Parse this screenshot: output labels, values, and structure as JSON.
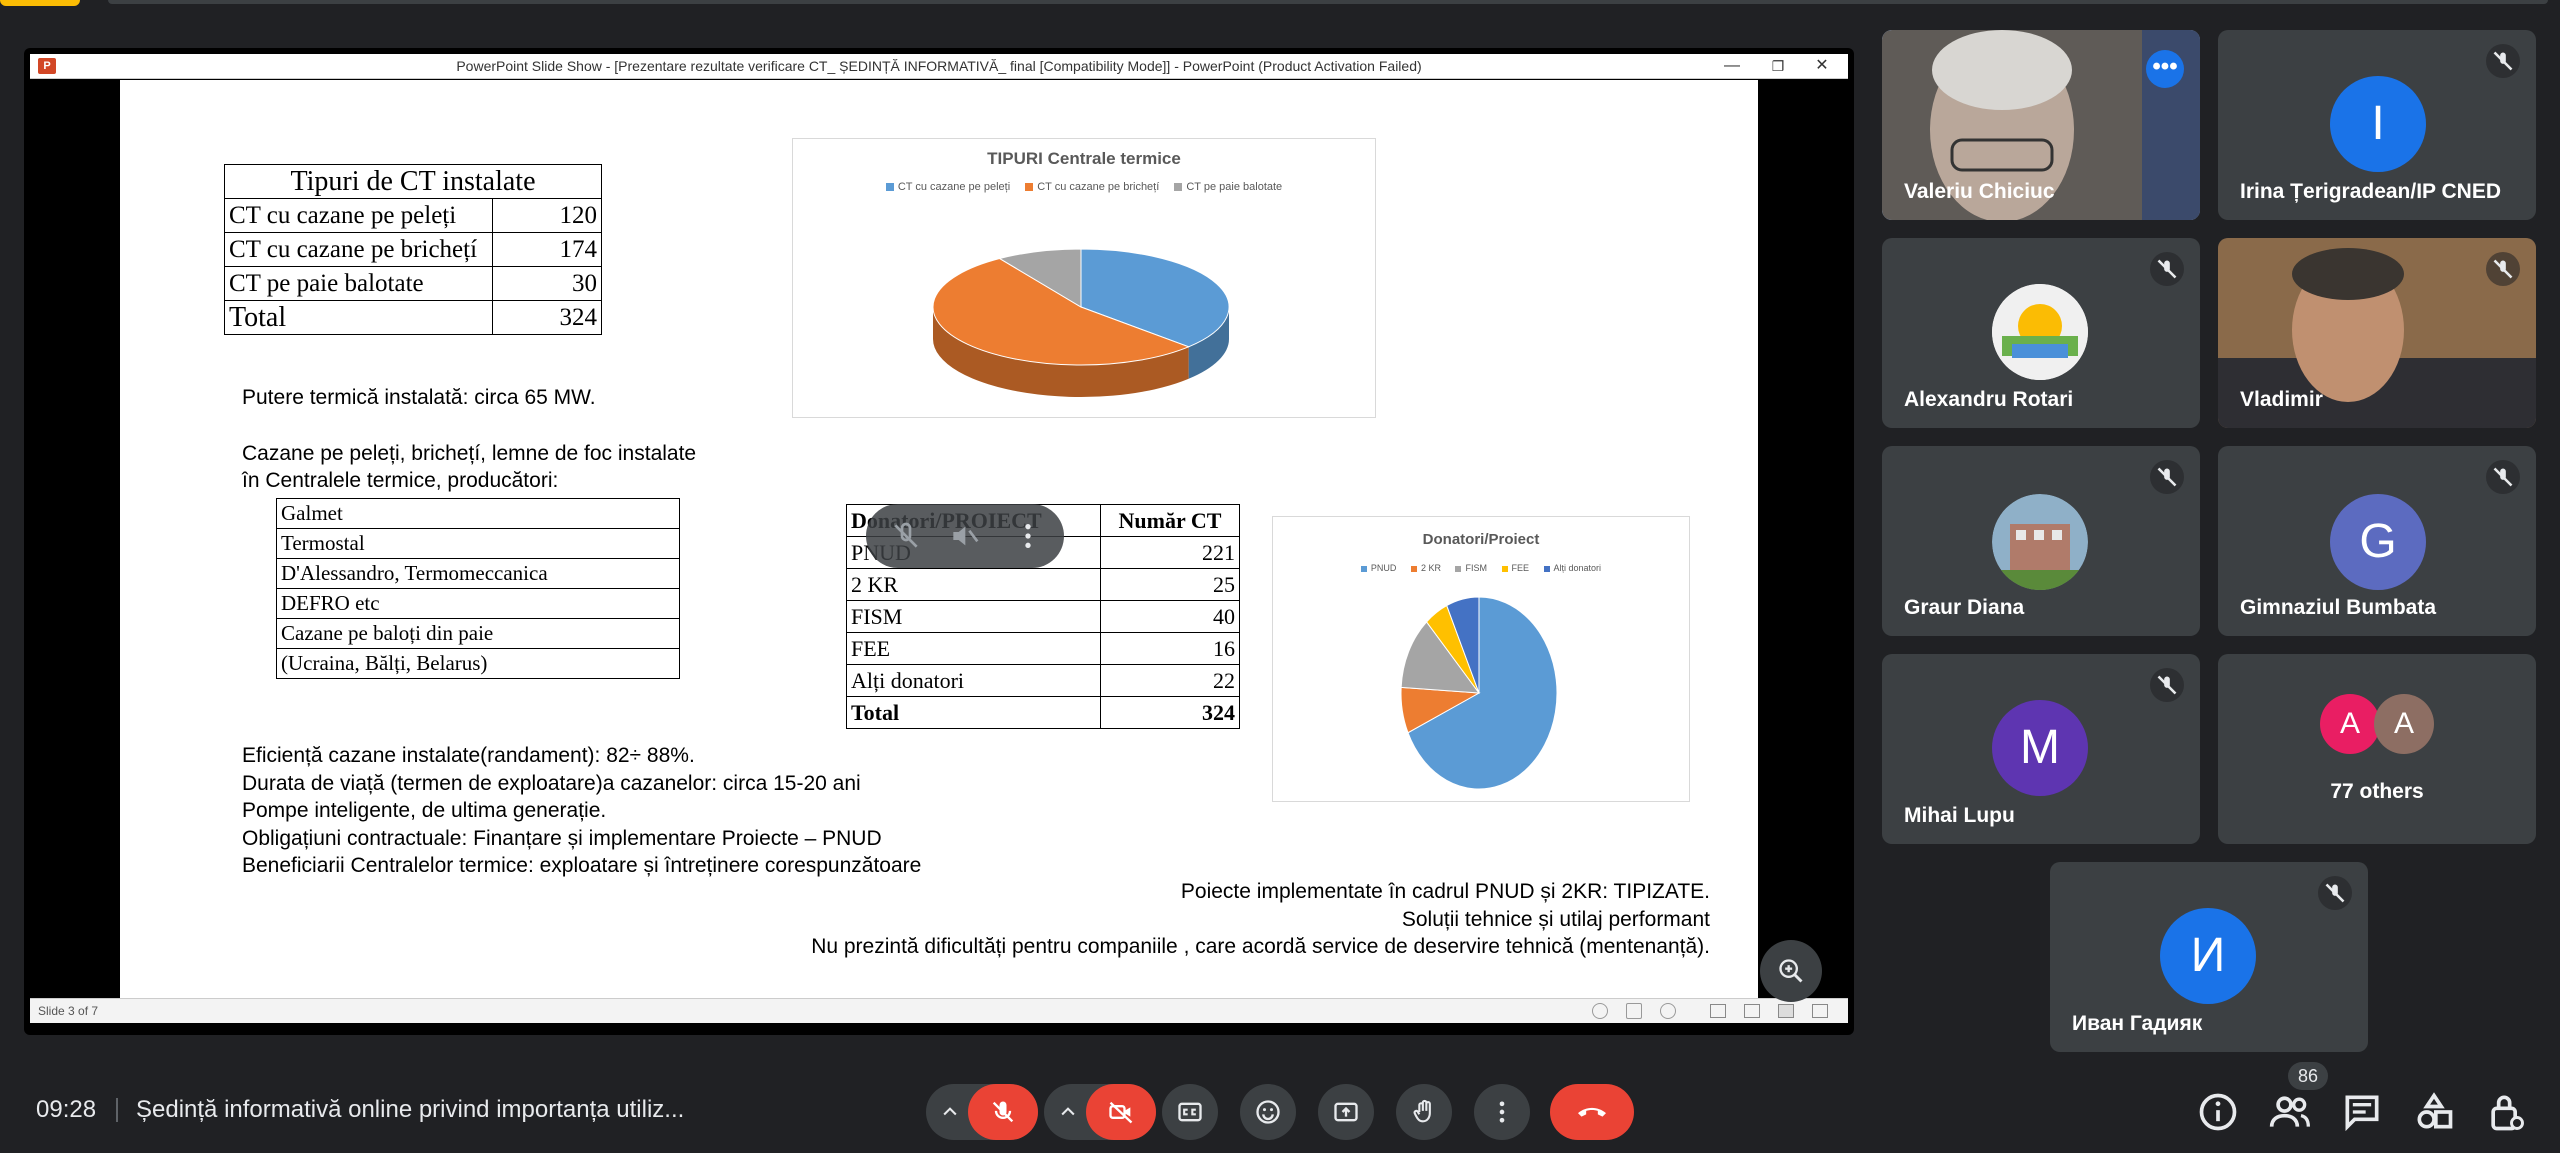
{
  "screen_share": {
    "window_title": "PowerPoint Slide Show - [Prezentare rezultate verificare CT_ ȘEDINȚĂ INFORMATIVĂ_ final [Compatibility Mode]] - PowerPoint (Product Activation Failed)",
    "app_logo": "P",
    "status_text": "Slide 3 of 7",
    "window_controls": [
      "—",
      "❐",
      "✕"
    ]
  },
  "slide": {
    "ct_table": {
      "title": "Tipuri de CT instalate",
      "rows": [
        {
          "label": "CT cu cazane pe peleți",
          "value": "120"
        },
        {
          "label": "CT cu cazane pe brichețí",
          "value": "174"
        },
        {
          "label": "CT pe paie balotate",
          "value": "30"
        },
        {
          "label": "Total",
          "value": "324"
        }
      ]
    },
    "putere": "Putere termică instalată: circa 65 MW.",
    "cazane_line1": "Cazane pe peleți, brichețí, lemne de foc instalate",
    "cazane_line2": "în Centralele termice, producători:",
    "producatori": [
      "Galmet",
      "Termostal",
      "D'Alessandro,  Termomeccanica",
      "DEFRO etc",
      "Cazane pe baloți din paie",
      "(Ucraina, Bălți, Belarus)"
    ],
    "donors_table": {
      "headers": [
        "Donatori/PROIECT",
        "Număr CT"
      ],
      "rows": [
        {
          "label": "PNUD",
          "value": "221"
        },
        {
          "label": "2 KR",
          "value": "25"
        },
        {
          "label": "FISM",
          "value": "40"
        },
        {
          "label": "FEE",
          "value": "16"
        },
        {
          "label": "Alți donatori",
          "value": "22"
        }
      ],
      "total_label": "Total",
      "total_value": "324"
    },
    "bullets": [
      "Eficiență cazane instalate(randament): 82÷ 88%.",
      "Durata de viață (termen de exploatare)a cazanelor: circa 15-20 ani",
      "Pompe inteligente, de ultima generație.",
      "Obligațiuni contractuale: Finanțare și implementare Proiecte – PNUD",
      "Beneficiarii Centralelor termice: exploatare și întreținere corespunzătoare"
    ],
    "right_notes": [
      "Poiecte implementate în cadrul PNUD și 2KR: TIPIZATE.",
      "Soluții tehnice și utilaj performant",
      "Nu prezintă dificultăți pentru companiile , care acordă service de deservire tehnică (mentenanță)."
    ]
  },
  "chart_data": [
    {
      "type": "pie",
      "title": "TIPURI Centrale termice",
      "categories": [
        "CT cu cazane pe peleți",
        "CT cu cazane pe brichețí",
        "CT pe paie balotate"
      ],
      "values": [
        120,
        174,
        30
      ],
      "colors": [
        "#5b9bd5",
        "#ed7d31",
        "#a5a5a5"
      ],
      "style": "3d",
      "legend": "top"
    },
    {
      "type": "pie",
      "title": "Donatori/Proiect",
      "categories": [
        "PNUD",
        "2 KR",
        "FISM",
        "FEE",
        "Alți donatori"
      ],
      "values": [
        221,
        25,
        40,
        16,
        22
      ],
      "colors": [
        "#5b9bd5",
        "#ed7d31",
        "#a5a5a5",
        "#ffc000",
        "#4472c4"
      ],
      "legend": "top"
    }
  ],
  "participants": [
    {
      "name": "Valeriu Chiciuc",
      "type": "video",
      "active": true
    },
    {
      "name": "Irina Țerigradean/IP CNED",
      "initial": "I",
      "color": "#1a73e8",
      "muted": true
    },
    {
      "name": "Alexandru Rotari",
      "type": "image",
      "muted": true
    },
    {
      "name": "Vladimir",
      "type": "video",
      "muted": true
    },
    {
      "name": "Graur Diana",
      "type": "image",
      "muted": true
    },
    {
      "name": "Gimnaziul Bumbata",
      "initial": "G",
      "color": "#5c6bc0",
      "muted": true
    },
    {
      "name": "Mihai Lupu",
      "initial": "M",
      "color": "#5e35b1",
      "muted": true
    },
    {
      "name": "77 others",
      "initials": [
        "A",
        "A"
      ],
      "colors": [
        "#e91e63",
        "#8d6e63"
      ]
    },
    {
      "name": "Иван Гадияк",
      "initial": "И",
      "color": "#1a73e8",
      "muted": true
    }
  ],
  "bottom_bar": {
    "time": "09:28",
    "meeting_title": "Ședință informativă online privind importanța utiliz...",
    "people_count": "86"
  },
  "icons": [
    "microphone-off-icon",
    "camera-off-icon",
    "captions-icon",
    "emoji-icon",
    "present-icon",
    "raise-hand-icon",
    "more-options-icon",
    "end-call-icon",
    "info-icon",
    "people-icon",
    "chat-icon",
    "activities-icon",
    "host-controls-icon"
  ]
}
